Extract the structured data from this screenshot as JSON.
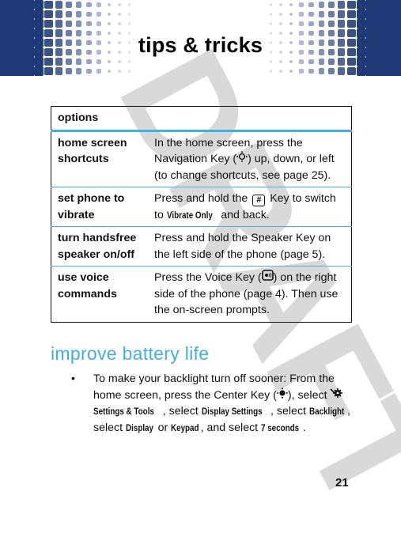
{
  "header": {
    "title": "tips & tricks",
    "band_color": "#1f3a76"
  },
  "watermark": "DRAFT",
  "options_table": {
    "header": "options",
    "rows": [
      {
        "feature": "home screen shortcuts",
        "desc_parts": [
          "In the home screen, press the Navigation Key (",
          ") up, down, or left (to change shortcuts, see page 25)."
        ],
        "icon": "navigation-key-icon"
      },
      {
        "feature": "set phone to vibrate",
        "desc_parts": [
          "Press and hold the ",
          " Key to switch to ",
          " and back."
        ],
        "key_label": "#",
        "menu_item": "Vibrate Only",
        "icon": "pound-key-icon"
      },
      {
        "feature": "turn handsfree speaker on/off",
        "desc": "Press and hold the Speaker Key on the left side of the phone (page 5)."
      },
      {
        "feature": "use voice commands",
        "desc_parts": [
          "Press the Voice Key (",
          ") on the right side of the phone (page 4). Then use the on-screen prompts."
        ],
        "icon": "voice-key-icon"
      }
    ]
  },
  "section": {
    "heading": "improve battery life",
    "bullet": {
      "symbol": "•",
      "parts": [
        "To make your backlight turn off sooner: From the home screen, press the Center Key (",
        "), select ",
        "Settings & Tools",
        ", select ",
        "Display Settings",
        ", select ",
        "Backlight",
        ", select ",
        "Display",
        " or ",
        "Keypad",
        ", and select ",
        "7 seconds",
        "."
      ]
    }
  },
  "page_number": "21",
  "colors": {
    "accent_blue": "#45aee0",
    "band_blue": "#1f3a76",
    "watermark_gray": "#d9d9d9"
  }
}
